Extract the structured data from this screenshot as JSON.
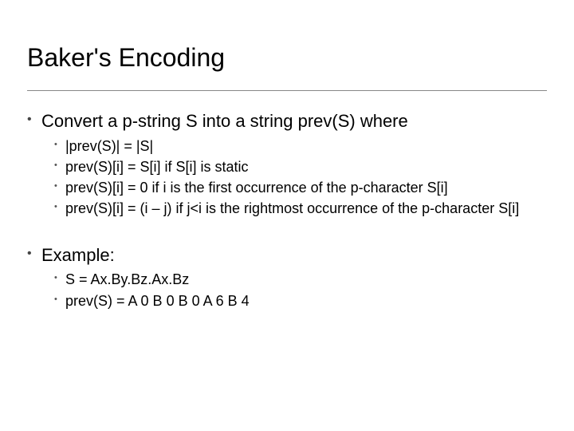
{
  "title": "Baker's Encoding",
  "body": [
    {
      "text": "Convert a p-string S into a string prev(S) where",
      "sub": [
        "|prev(S)| = |S|",
        "prev(S)[i] = S[i] if S[i] is static",
        "prev(S)[i] = 0 if i is the first occurrence of the p-character S[i]",
        "prev(S)[i] = (i – j) if j<i is the rightmost occurrence of the p-character S[i]"
      ]
    },
    {
      "text": "Example:",
      "sub": [
        "S = Ax.By.Bz.Ax.Bz",
        "prev(S) = A 0 B 0 B 0 A 6 B 4"
      ]
    }
  ]
}
